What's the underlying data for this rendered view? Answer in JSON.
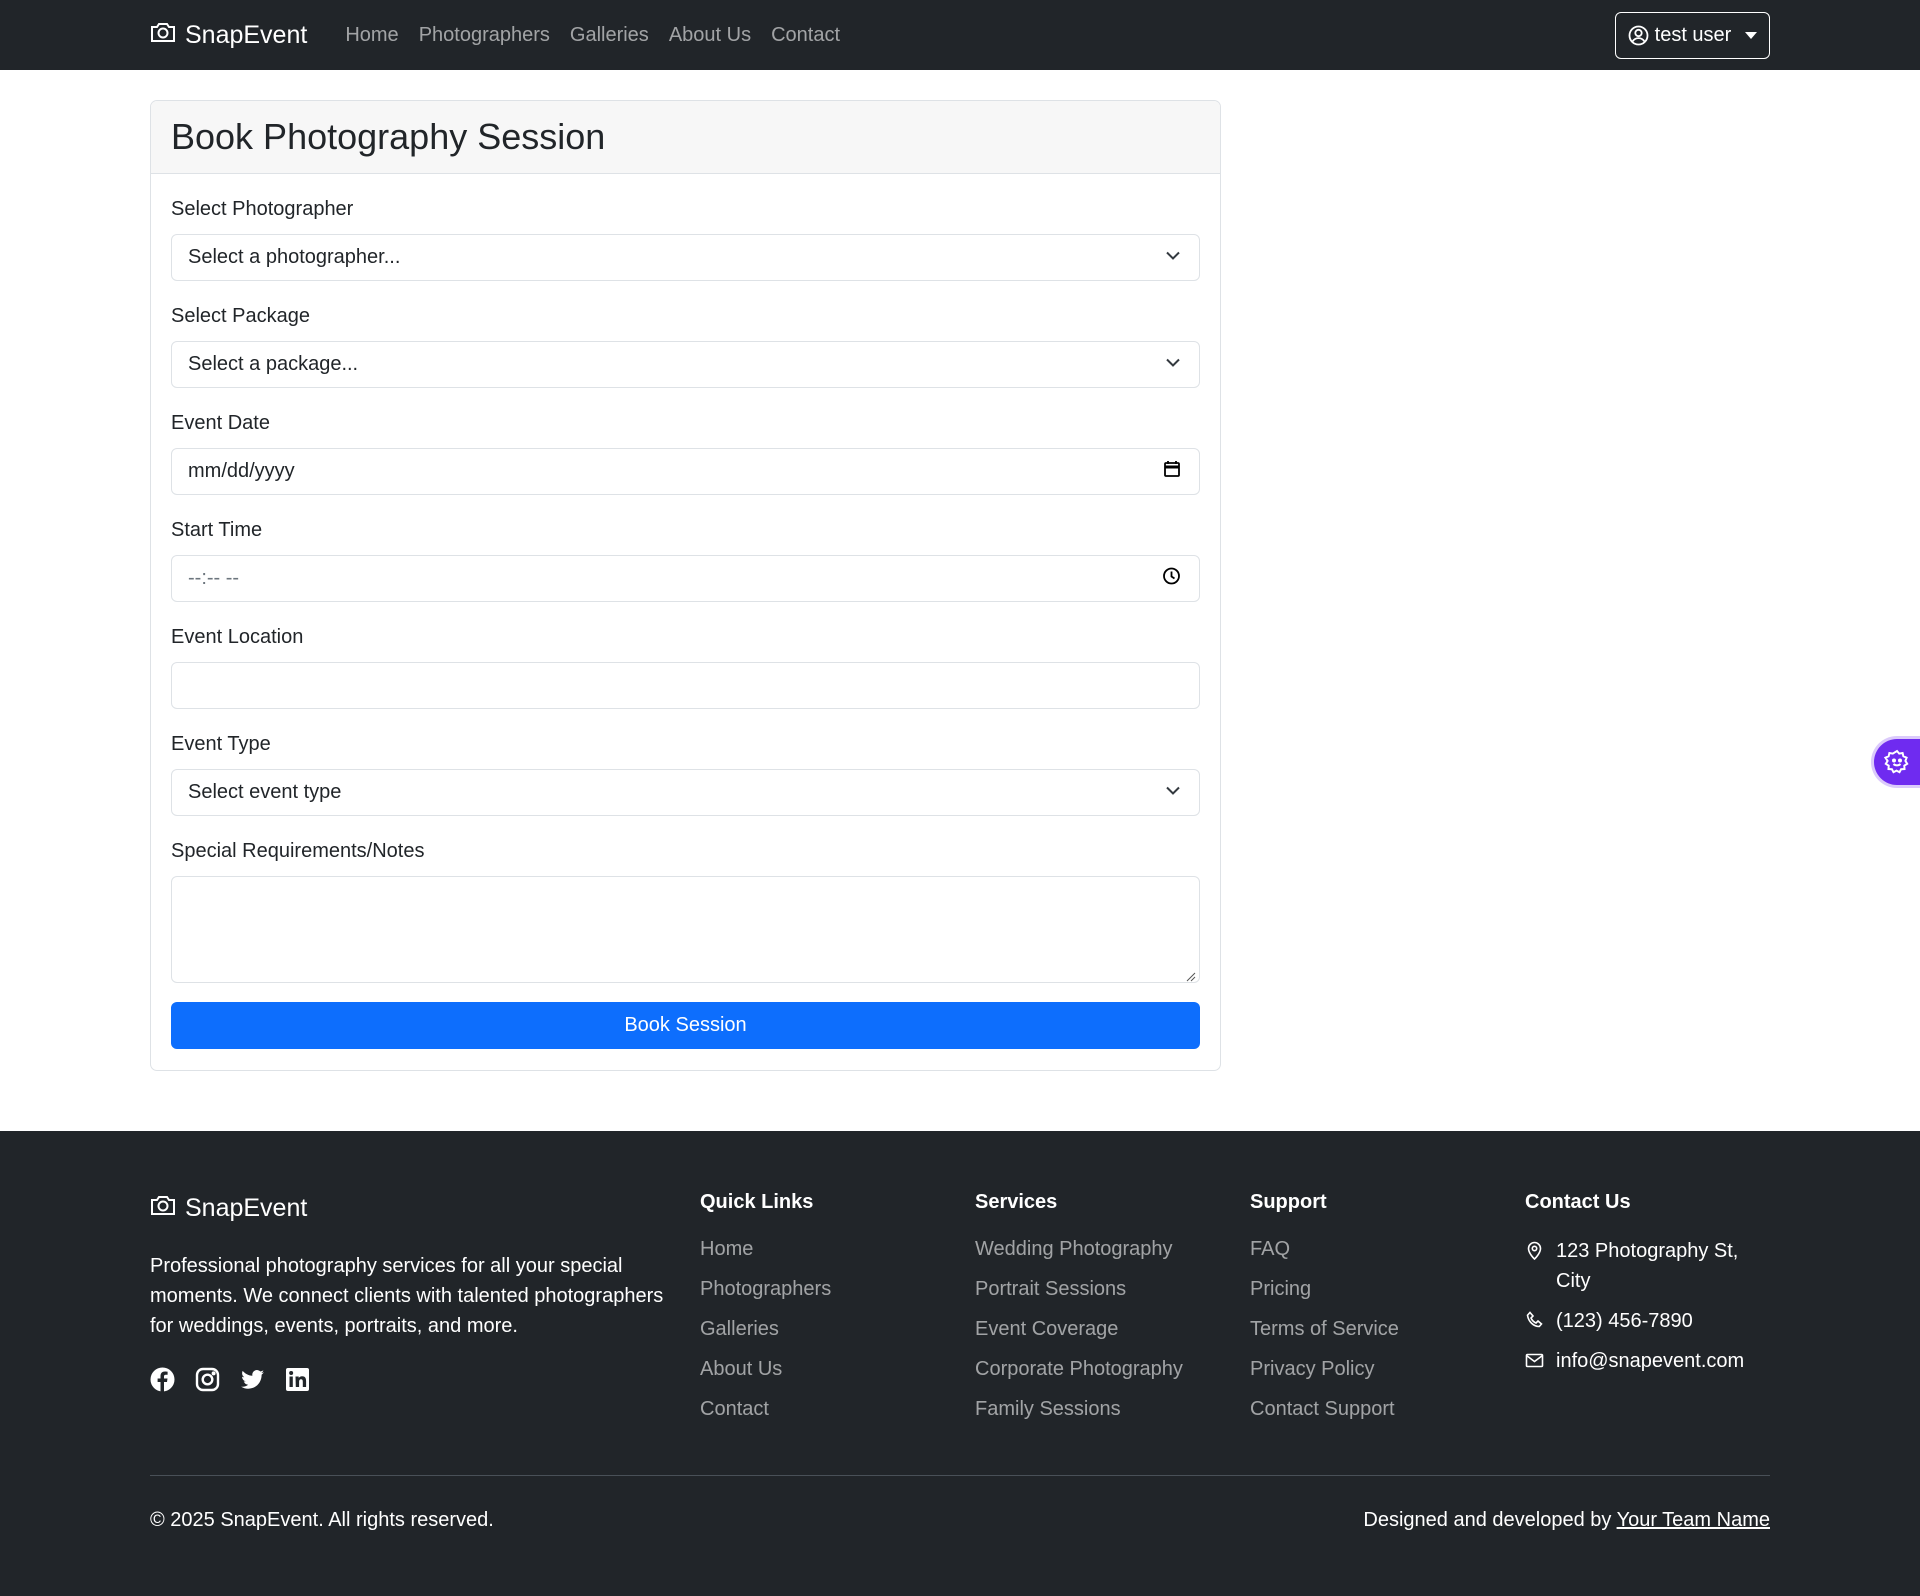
{
  "navbar": {
    "brand": "SnapEvent",
    "links": [
      "Home",
      "Photographers",
      "Galleries",
      "About Us",
      "Contact"
    ],
    "user": "test user"
  },
  "form": {
    "title": "Book Photography Session",
    "photographer_label": "Select Photographer",
    "photographer_value": "Select a photographer...",
    "package_label": "Select Package",
    "package_value": "Select a package...",
    "date_label": "Event Date",
    "date_value": "mm/dd/yyyy",
    "time_label": "Start Time",
    "time_value": "--:-- --",
    "location_label": "Event Location",
    "location_value": "",
    "type_label": "Event Type",
    "type_value": "Select event type",
    "notes_label": "Special Requirements/Notes",
    "notes_value": "",
    "submit": "Book Session"
  },
  "footer": {
    "brand": "SnapEvent",
    "about": "Professional photography services for all your special moments. We connect clients with talented photographers for weddings, events, portraits, and more.",
    "quick_links": {
      "heading": "Quick Links",
      "items": [
        "Home",
        "Photographers",
        "Galleries",
        "About Us",
        "Contact"
      ]
    },
    "services": {
      "heading": "Services",
      "items": [
        "Wedding Photography",
        "Portrait Sessions",
        "Event Coverage",
        "Corporate Photography",
        "Family Sessions"
      ]
    },
    "support": {
      "heading": "Support",
      "items": [
        "FAQ",
        "Pricing",
        "Terms of Service",
        "Privacy Policy",
        "Contact Support"
      ]
    },
    "contact": {
      "heading": "Contact Us",
      "address": "123 Photography St, City",
      "phone": "(123) 456-7890",
      "email": "info@snapevent.com"
    },
    "copyright": "© 2025 SnapEvent. All rights reserved.",
    "credits_prefix": "Designed and developed by",
    "credits_link": "Your Team Name"
  },
  "icons": [
    "camera-icon",
    "user-circle-icon",
    "caret-down-icon",
    "chevron-down-icon",
    "calendar-icon",
    "clock-icon",
    "facebook-icon",
    "instagram-icon",
    "twitter-icon",
    "linkedin-icon",
    "location-pin-icon",
    "phone-icon",
    "envelope-icon",
    "settings-widget-icon"
  ],
  "colors": {
    "navbar_bg": "#212529",
    "primary": "#0d6efd",
    "widget": "#6f2bf0"
  }
}
